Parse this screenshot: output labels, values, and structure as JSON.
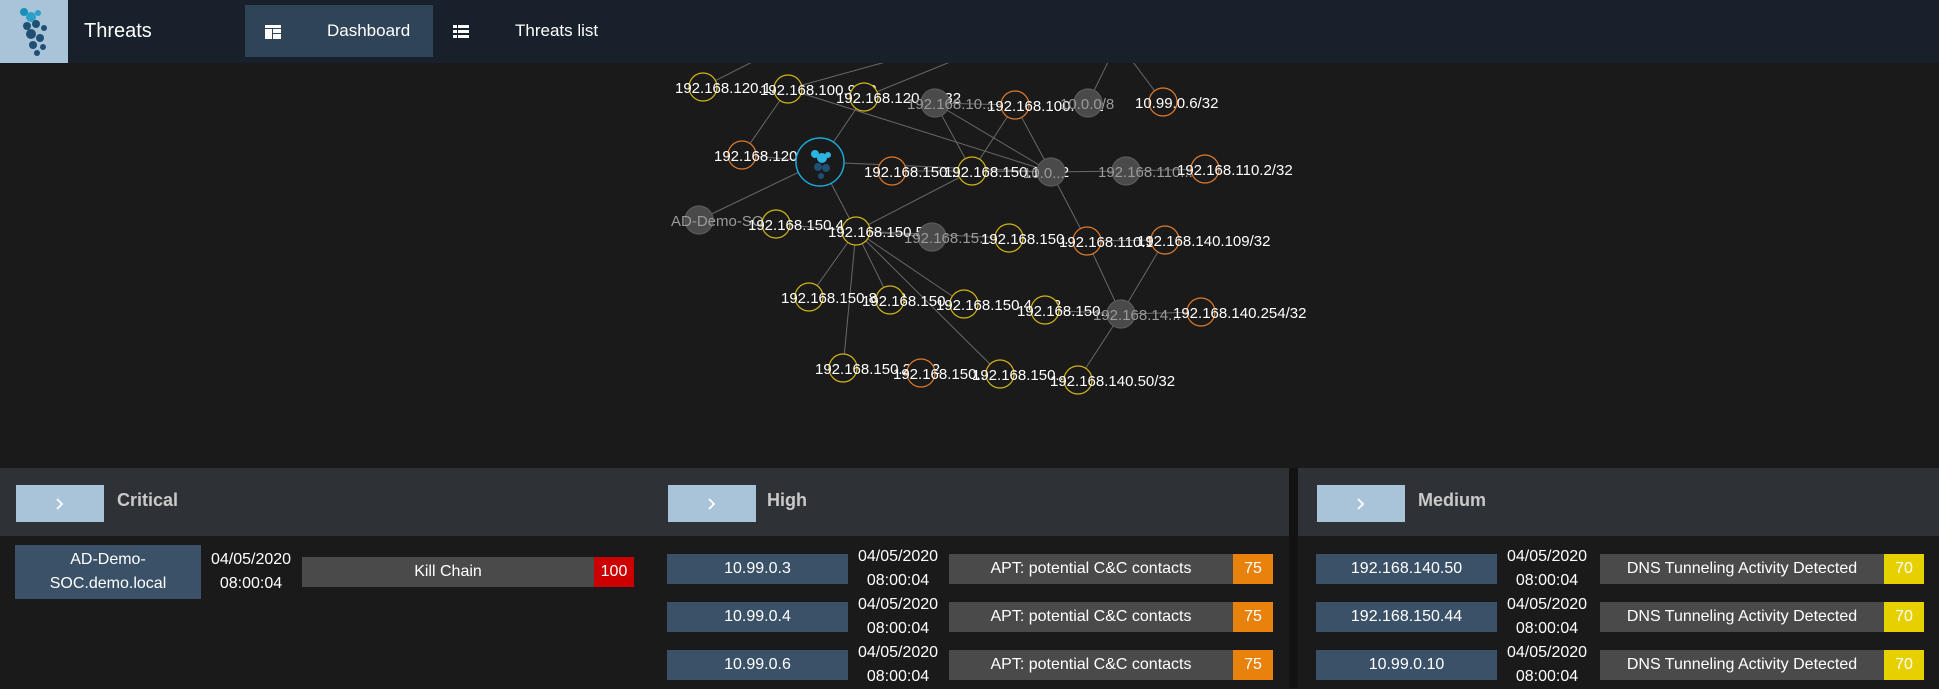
{
  "header": {
    "title": "Threats",
    "logo_icon": "company-logo",
    "tabs": [
      {
        "label": "Dashboard",
        "icon": "dashboard-icon",
        "active": true
      },
      {
        "label": "Threats list",
        "icon": "list-icon",
        "active": false
      }
    ]
  },
  "graph": {
    "nodes": [
      {
        "label": "192.168.120.1...",
        "kind": "yellow"
      },
      {
        "label": "192.168.100.9/32",
        "kind": "yellow"
      },
      {
        "label": "192.168.120.23/32",
        "kind": "yellow"
      },
      {
        "label": "192.168.10...",
        "kind": "gray"
      },
      {
        "label": "192.168.100.5/32",
        "kind": "orange"
      },
      {
        "label": "10.0.0/8",
        "kind": "gray"
      },
      {
        "label": "10.99.0.6/32",
        "kind": "orange"
      },
      {
        "label": "192.168.120.12/32",
        "kind": "orange"
      },
      {
        "label": "",
        "kind": "center"
      },
      {
        "label": "192.168.150...",
        "kind": "orange"
      },
      {
        "label": "192.168.150.10/32",
        "kind": "yellow"
      },
      {
        "label": "10.0...",
        "kind": "gray"
      },
      {
        "label": "192.168.110...",
        "kind": "gray"
      },
      {
        "label": "192.168.110.2/32",
        "kind": "orange"
      },
      {
        "label": "AD-Demo-SO...",
        "kind": "gray"
      },
      {
        "label": "192.168.150.4/32",
        "kind": "yellow"
      },
      {
        "label": "192.168.150.5/32",
        "kind": "yellow"
      },
      {
        "label": "192.168.15...",
        "kind": "gray"
      },
      {
        "label": "192.168.150...",
        "kind": "yellow"
      },
      {
        "label": "192.168.110.1/32",
        "kind": "orange"
      },
      {
        "label": "192.168.140.109/32",
        "kind": "orange"
      },
      {
        "label": "192.168.150.89/32",
        "kind": "yellow"
      },
      {
        "label": "192.168.150...",
        "kind": "yellow"
      },
      {
        "label": "192.168.150.41/32",
        "kind": "yellow"
      },
      {
        "label": "192.168.150...",
        "kind": "yellow"
      },
      {
        "label": "192.168.14...",
        "kind": "gray"
      },
      {
        "label": "192.168.140.254/32",
        "kind": "orange"
      },
      {
        "label": "192.168.150.23/32",
        "kind": "yellow"
      },
      {
        "label": "192.168.150...",
        "kind": "orange"
      },
      {
        "label": "192.168.150...",
        "kind": "yellow"
      },
      {
        "label": "192.168.140.50/32",
        "kind": "yellow"
      }
    ]
  },
  "panels": [
    {
      "title": "Critical",
      "button_icon": "chevron-right-icon",
      "rows": [
        {
          "host": "AD-Demo-SOC.demo.local",
          "date": "04/05/2020",
          "time": "08:00:04",
          "threat": "Kill Chain",
          "score": "100"
        }
      ]
    },
    {
      "title": "High",
      "button_icon": "chevron-right-icon",
      "rows": [
        {
          "host": "10.99.0.3",
          "date": "04/05/2020",
          "time": "08:00:04",
          "threat": "APT: potential C&C contacts",
          "score": "75"
        },
        {
          "host": "10.99.0.4",
          "date": "04/05/2020",
          "time": "08:00:04",
          "threat": "APT: potential C&C contacts",
          "score": "75"
        },
        {
          "host": "10.99.0.6",
          "date": "04/05/2020",
          "time": "08:00:04",
          "threat": "APT: potential C&C contacts",
          "score": "75"
        }
      ]
    },
    {
      "title": "Medium",
      "button_icon": "chevron-right-icon",
      "rows": [
        {
          "host": "192.168.140.50",
          "date": "04/05/2020",
          "time": "08:00:04",
          "threat": "DNS Tunneling Activity Detected",
          "score": "70"
        },
        {
          "host": "192.168.150.44",
          "date": "04/05/2020",
          "time": "08:00:04",
          "threat": "DNS Tunneling Activity Detected",
          "score": "70"
        },
        {
          "host": "10.99.0.10",
          "date": "04/05/2020",
          "time": "08:00:04",
          "threat": "DNS Tunneling Activity Detected",
          "score": "70"
        }
      ]
    }
  ],
  "colors": {
    "critical": "#cc0000",
    "high": "#e8820c",
    "medium": "#e6d000",
    "node_yellow": "#d4b514",
    "node_orange": "#e07b2a",
    "node_gray": "#5a5a5a",
    "accent": "#a9c3d8"
  }
}
